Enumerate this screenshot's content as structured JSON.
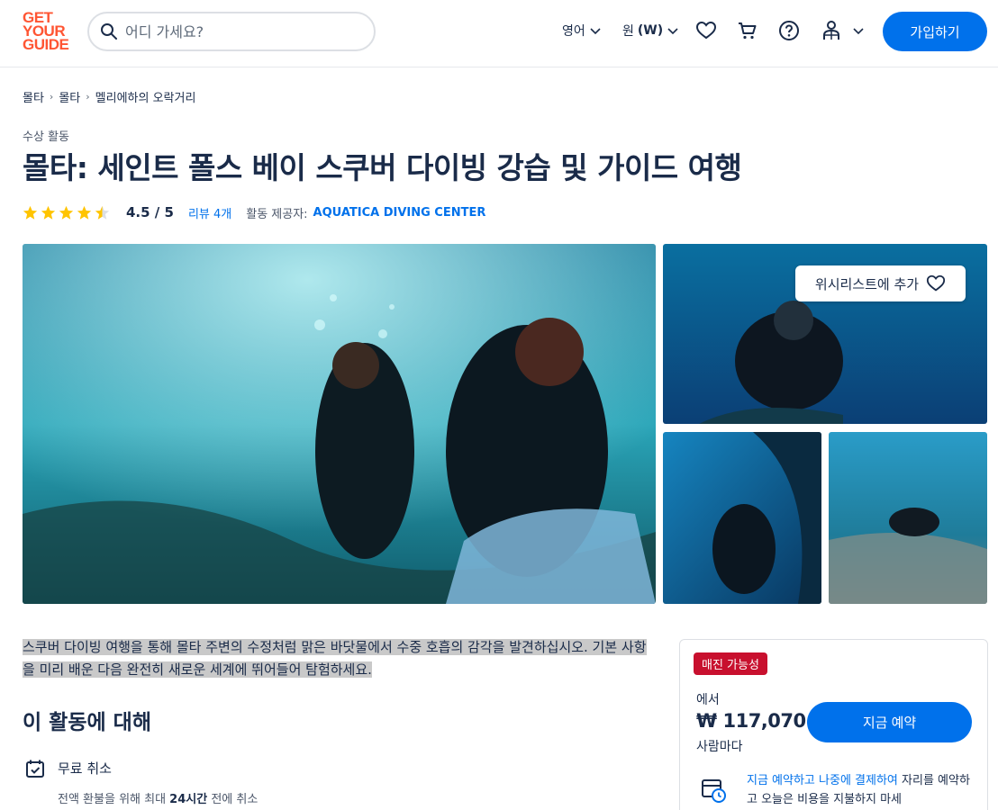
{
  "header": {
    "logo_lines": [
      "GET",
      "YOUR",
      "GUIDE"
    ],
    "search_placeholder": "어디 가세요?",
    "language": "영어",
    "currency_label": "원",
    "currency_code": "(W)",
    "signup_label": "가입하기"
  },
  "breadcrumb": [
    "몰타",
    "몰타",
    "멜리에하의 오락거리"
  ],
  "activity": {
    "category": "수상 활동",
    "title": "몰타: 세인트 폴스 베이 스쿠버 다이빙 강습 및 가이드 여행",
    "rating_value": 4.5,
    "rating_text": "4.5 / 5",
    "reviews": "리뷰 4개",
    "provider_label": "활동 제공자:",
    "provider": "AQUATICA DIVING CENTER"
  },
  "gallery": {
    "wishlist_label": "위시리스트에 추가"
  },
  "description": "스쿠버 다이빙 여행을 통해 몰타 주변의 수정처럼 맑은 바닷물에서 수중 호흡의 감각을 발견하십시오. 기본 사항을 미리 배운 다음 완전히 새로운 세계에 뛰어들어 탐험하세요.",
  "about": {
    "heading": "이 활동에 대해",
    "feature_title": "무료 취소",
    "feature_desc_prefix": "전액 환불을 위해 최대 ",
    "feature_desc_bold": "24시간",
    "feature_desc_suffix": " 전에 취소"
  },
  "booking": {
    "badge": "매진 가능성",
    "from": "에서",
    "price": "₩ 117,070",
    "per": "사람마다",
    "book_label": "지금 예약",
    "reserve_link": "지금 예약하고 나중에 결제하여",
    "reserve_text": " 자리를 예약하고 오늘은 비용을 지불하지 마세"
  },
  "colors": {
    "brand": "#ff5533",
    "primary": "#0071eb",
    "badge": "#c8102e",
    "star": "#ffc400"
  }
}
